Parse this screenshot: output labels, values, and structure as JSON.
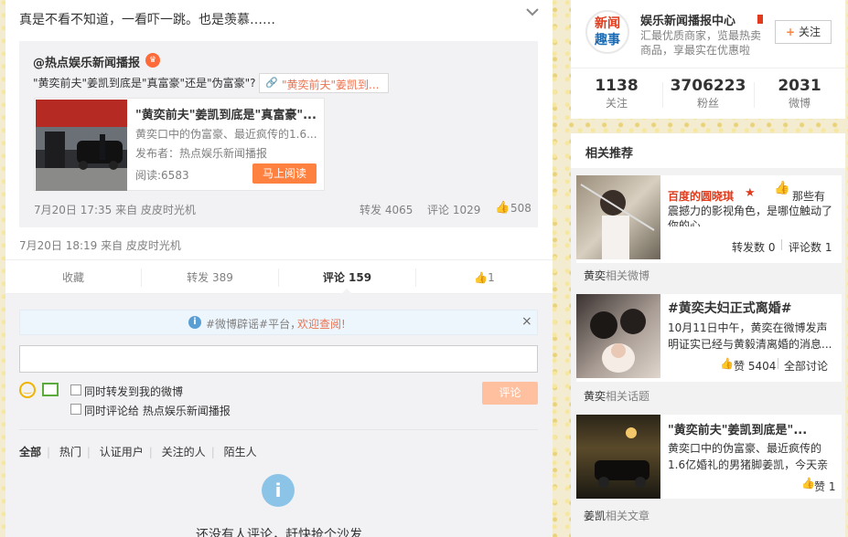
{
  "post": {
    "text": "真是不看不知道，一看吓一跳。也是羡慕……",
    "footer": "7月20日 18:19 来自 皮皮时光机"
  },
  "repost": {
    "author": "@热点娱乐新闻播报",
    "text": "\"黄奕前夫\"姜凯到底是\"真富豪\"还是\"伪富豪\"?",
    "link_label": "\"黄奕前夫\"姜凯到...",
    "card": {
      "title": "\"黄奕前夫\"姜凯到底是\"真富豪\"...",
      "desc": "黄奕口中的伪富豪、最近疯传的1.6...",
      "publisher": "发布者：热点娱乐新闻播报",
      "reads": "阅读:6583",
      "read_btn": "马上阅读"
    },
    "footer": "7月20日 17:35 来自 皮皮时光机",
    "repost_count": "转发 4065",
    "comment_count": "评论 1029",
    "like_count": "508"
  },
  "actions": {
    "fav": "收藏",
    "repost": "转发 389",
    "comment": "评论 159",
    "like": "1"
  },
  "notice": {
    "text": "#微博辟谣#平台，",
    "link": "欢迎查阅!"
  },
  "comment_box": {
    "placeholder": "",
    "option1": "同时转发到我的微博",
    "option2": "同时评论给 热点娱乐新闻播报",
    "submit": "评论"
  },
  "filters": [
    "全部",
    "热门",
    "认证用户",
    "关注的人",
    "陌生人"
  ],
  "empty": {
    "text": "还没有人评论，赶快抢个沙发"
  },
  "profile": {
    "logo_line1": "新闻",
    "logo_line2": "趣事",
    "name": "娱乐新闻播报中心",
    "desc_line1": "汇最优质商家，览最热卖",
    "desc_line2": "商品，享最实在优惠啦",
    "follow": "关注",
    "stats": [
      {
        "num": "1138",
        "label": "关注"
      },
      {
        "num": "3706223",
        "label": "粉丝"
      },
      {
        "num": "2031",
        "label": "微博"
      }
    ]
  },
  "related": {
    "title": "相关推荐",
    "items": [
      {
        "author": "百度的圆晓琪",
        "text_line1": "那些有",
        "text_line2": "震撼力的影视角色，是哪位触动了",
        "text_line3": "你的心",
        "meta1": "转发数 0",
        "meta2": "评论数 1",
        "tag_bold": "黄奕",
        "tag_rest": "相关微博"
      },
      {
        "title": "#黄奕夫妇正式离婚#",
        "text_line1": "10月11日中午，黄奕在微博发声",
        "text_line2": "明证实已经与黄毅清离婚的消息...",
        "meta1": "赞 5404",
        "meta2": "全部讨论",
        "tag_bold": "黄奕",
        "tag_rest": "相关话题"
      },
      {
        "title": "\"黄奕前夫\"姜凯到底是\"...",
        "text_line1": "黄奕口中的伪富豪、最近疯传的",
        "text_line2": "1.6亿婚礼的男猪脚姜凯，今天亲",
        "meta1": "赞 1",
        "tag_bold": "姜凯",
        "tag_rest": "相关文章"
      }
    ]
  },
  "colors": {
    "accent_orange": "#ff8140",
    "link_blue": "#eb7350",
    "brand_red": "#e03b1c"
  }
}
